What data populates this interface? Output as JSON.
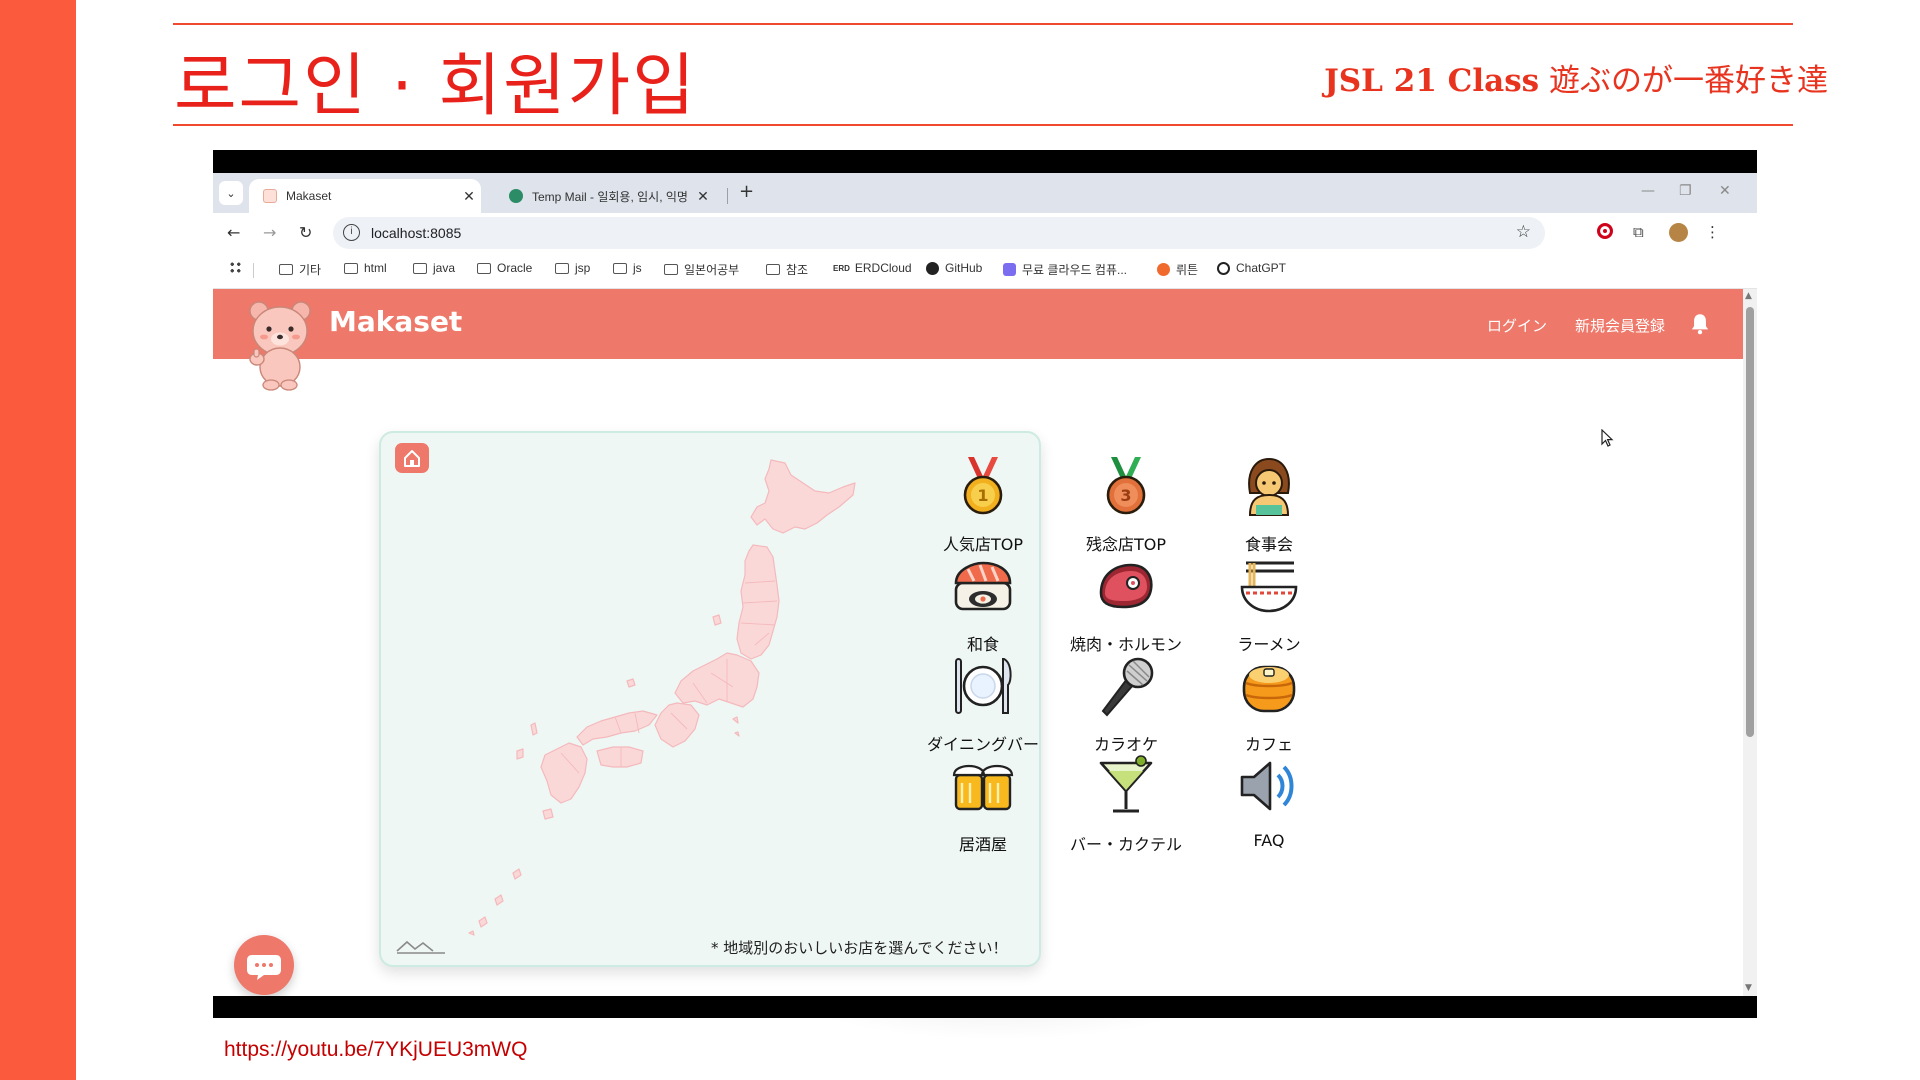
{
  "slide": {
    "title": "로그인 · 회원가입",
    "subtitle_bold": "JSL 21 Class",
    "subtitle_jp": "遊ぶのが一番好き達",
    "video_link": "https://youtu.be/7YKjUEU3mWQ"
  },
  "browser": {
    "tabs": [
      {
        "label": "Makaset",
        "active": true
      },
      {
        "label": "Temp Mail - 일회용, 임시, 익명",
        "active": false
      }
    ],
    "url": "localhost:8085",
    "bookmarks": [
      {
        "label": "기타",
        "type": "folder"
      },
      {
        "label": "html",
        "type": "folder"
      },
      {
        "label": "java",
        "type": "folder"
      },
      {
        "label": "Oracle",
        "type": "folder"
      },
      {
        "label": "jsp",
        "type": "folder"
      },
      {
        "label": "js",
        "type": "folder"
      },
      {
        "label": "일본어공부",
        "type": "folder"
      },
      {
        "label": "참조",
        "type": "folder"
      },
      {
        "label": "ERDCloud",
        "type": "link"
      },
      {
        "label": "GitHub",
        "type": "link"
      },
      {
        "label": "무료 클라우드 컴퓨...",
        "type": "link"
      },
      {
        "label": "뤼튼",
        "type": "link"
      },
      {
        "label": "ChatGPT",
        "type": "link"
      }
    ],
    "erd_badge": "ERD"
  },
  "site": {
    "brand": "Makaset",
    "nav": {
      "login": "ログイン",
      "register": "新規会員登録"
    },
    "map_caption": "* 地域別のおいしいお店を選んでください！",
    "categories": [
      {
        "label": "人気店TOP",
        "icon": "gold-medal-icon"
      },
      {
        "label": "残念店TOP",
        "icon": "bronze-medal-icon"
      },
      {
        "label": "食事会",
        "icon": "woman-icon"
      },
      {
        "label": "和食",
        "icon": "sushi-icon"
      },
      {
        "label": "焼肉・ホルモン",
        "icon": "meat-icon"
      },
      {
        "label": "ラーメン",
        "icon": "ramen-icon"
      },
      {
        "label": "ダイニングバー",
        "icon": "plate-cutlery-icon"
      },
      {
        "label": "カラオケ",
        "icon": "microphone-icon"
      },
      {
        "label": "カフェ",
        "icon": "pancake-icon"
      },
      {
        "label": "居酒屋",
        "icon": "beer-mugs-icon"
      },
      {
        "label": "バー・カクテル",
        "icon": "cocktail-icon"
      },
      {
        "label": "FAQ",
        "icon": "speaker-icon"
      }
    ]
  },
  "colors": {
    "slide_accent": "#fb5a3c",
    "header": "#ee786a",
    "map_bg": "#eef7f4",
    "map_land": "#fbd8d8"
  }
}
